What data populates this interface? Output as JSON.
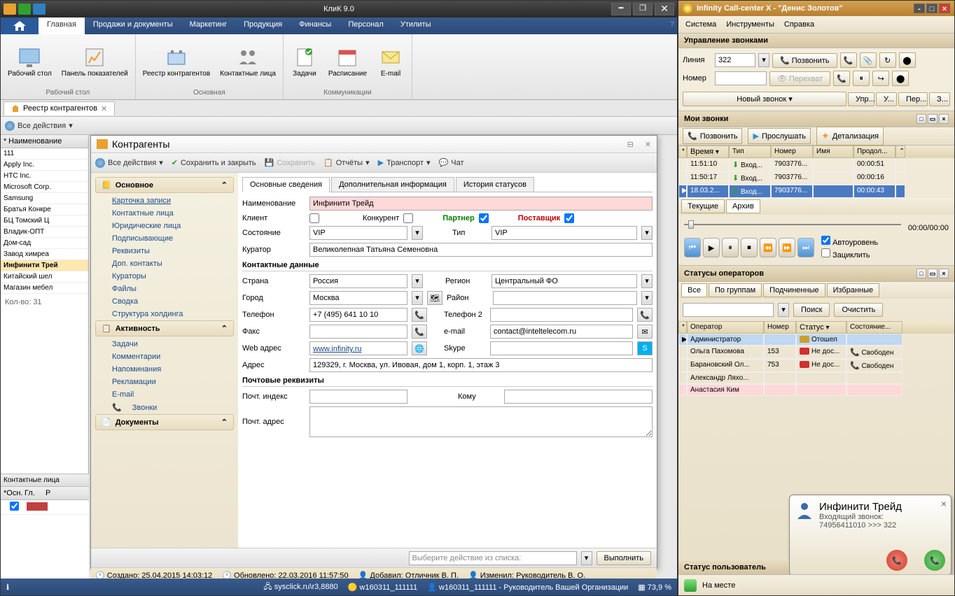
{
  "left": {
    "title": "КлиК 9.0",
    "ribbon": {
      "tabs": [
        "Главная",
        "Продажи и документы",
        "Маркетинг",
        "Продукция",
        "Финансы",
        "Персонал",
        "Утилиты"
      ],
      "groups": [
        {
          "label": "Рабочий стол",
          "items": [
            {
              "label": "Рабочий\nстол"
            },
            {
              "label": "Панель\nпоказателей"
            }
          ]
        },
        {
          "label": "Основная",
          "items": [
            {
              "label": "Реестр\nконтрагентов"
            },
            {
              "label": "Контактные\nлица"
            }
          ]
        },
        {
          "label": "Коммуникации",
          "items": [
            {
              "label": "Задачи"
            },
            {
              "label": "Расписание"
            },
            {
              "label": "E-mail"
            }
          ]
        }
      ]
    },
    "docTab": "Реестр контрагентов",
    "allActions": "Все действия",
    "listHeader": "Наименование",
    "listRows": [
      "111",
      "Apply Inc.",
      "HTC Inc.",
      "Microsoft Corp.",
      "Samsung",
      "Братья Конкре",
      "БЦ Томский Ц",
      "Владик-ОПТ",
      "Дом-сад",
      "Завод химреа",
      "Инфинити Трей",
      "Китайский шел",
      "Магазин мебел"
    ],
    "countLabel": "Кол-во: 31",
    "contactsTitle": "Контактные лица",
    "contactsCols": [
      "Осн.",
      "Гл.",
      "Р"
    ],
    "status": {
      "server": "sysclick.ru\\r3,8880",
      "w1": "w160311_111111",
      "w2": "w160311_111111 - Руководитель Вашей Организации",
      "pct": "73,9 %"
    }
  },
  "modal": {
    "title": "Контрагенты",
    "toolbar": {
      "allActions": "Все действия",
      "saveClose": "Сохранить и закрыть",
      "save": "Сохранить",
      "reports": "Отчёты",
      "transport": "Транспорт",
      "chat": "Чат"
    },
    "navGroups": [
      {
        "title": "Основное",
        "items": [
          "Карточка записи",
          "Контактные лица",
          "Юридические лица",
          "Подписывающие",
          "Реквизиты",
          "Доп. контакты",
          "Кураторы",
          "Файлы",
          "Сводка",
          "Структура холдинга"
        ]
      },
      {
        "title": "Активность",
        "items": [
          "Задачи",
          "Комментарии",
          "Напоминания",
          "Рекламации",
          "E-mail",
          "Звонки"
        ]
      },
      {
        "title": "Документы",
        "items": []
      }
    ],
    "formTabs": [
      "Основные сведения",
      "Дополнительная информация",
      "История статусов"
    ],
    "fields": {
      "nameLabel": "Наименование",
      "name": "Инфинити Трейд",
      "clientLabel": "Клиент",
      "competitorLabel": "Конкурент",
      "partnerLabel": "Партнер",
      "supplierLabel": "Поставщик",
      "stateLabel": "Состояние",
      "state": "VIP",
      "typeLabel": "Тип",
      "type": "VIP",
      "curatorLabel": "Куратор",
      "curator": "Великолепная Татьяна Семеновна",
      "contactSection": "Контактные данные",
      "countryLabel": "Страна",
      "country": "Россия",
      "regionLabel": "Регион",
      "region": "Центральный ФО",
      "cityLabel": "Город",
      "city": "Москва",
      "districtLabel": "Район",
      "district": "",
      "phoneLabel": "Телефон",
      "phone": "+7 (495) 641 10 10",
      "phone2Label": "Телефон 2",
      "phone2": "",
      "faxLabel": "Факс",
      "fax": "",
      "emailLabel": "e-mail",
      "email": "contact@inteltelecom.ru",
      "webLabel": "Web адрес",
      "web": "www.infinity.ru",
      "skypeLabel": "Skype",
      "skype": "",
      "addrLabel": "Адрес",
      "addr": "129329, г. Москва, ул. Ивовая, дом 1, корп. 1, этаж 3",
      "postSection": "Почтовые реквизиты",
      "postcodeLabel": "Почт. индекс",
      "toLabel": "Кому",
      "postAddrLabel": "Почт. адрес"
    },
    "actionPrompt": "Выберите действие из списка:",
    "execute": "Выполнить",
    "footer": {
      "created": "Создано: 25.04.2015 14:03:12",
      "updated": "Обновлено: 22.03.2016 11:57:50",
      "added": "Добавил: Отличник В. П.",
      "changed": "Изменил: Руководитель В. О."
    }
  },
  "right": {
    "title": "Infinity Call-center X - \"Денис Золотов\"",
    "menu": [
      "Система",
      "Инструменты",
      "Справка"
    ],
    "callCtrlTitle": "Управление звонками",
    "lineLabel": "Линия",
    "lineValue": "322",
    "numberLabel": "Номер",
    "numberValue": "",
    "callBtn": "Позвонить",
    "interceptBtn": "Перехват",
    "tabBar": [
      "Новый звонок",
      "Упр...",
      "У...",
      "Пер...",
      "З..."
    ],
    "myCallsTitle": "Мои звонки",
    "actionBtns": {
      "call": "Позвонить",
      "listen": "Прослушать",
      "detail": "Детализация"
    },
    "callsCols": [
      "Время",
      "Тип",
      "Номер",
      "Имя",
      "Продол..."
    ],
    "callsRows": [
      {
        "time": "11:51:10",
        "type": "Вход...",
        "num": "7903776...",
        "name": "",
        "dur": "00:00:51"
      },
      {
        "time": "11:50:17",
        "type": "Вход...",
        "num": "7903776...",
        "name": "",
        "dur": "00:00:16"
      },
      {
        "time": "18.03.2...",
        "type": "Вход...",
        "num": "7903776...",
        "name": "",
        "dur": "00:00:43",
        "sel": true
      }
    ],
    "callTabs": [
      "Текущие",
      "Архив"
    ],
    "playerTime": "00:00/00:00",
    "autoLevel": "Автоуровень",
    "loop": "Зациклить",
    "opStatusTitle": "Статусы операторов",
    "opTabs": [
      "Все",
      "По группам",
      "Подчиненные",
      "Избранные"
    ],
    "search": "Поиск",
    "clear": "Очистить",
    "opCols": [
      "Оператор",
      "Номер",
      "Статус",
      "Состояние..."
    ],
    "opRows": [
      {
        "name": "Администратор",
        "num": "",
        "status": "Отошел",
        "sc": "#c8a030",
        "state": "",
        "stc": ""
      },
      {
        "name": "Ольга Пахомова",
        "num": "153",
        "status": "Не дос...",
        "sc": "#d03030",
        "state": "Свободен",
        "stc": "#30a030"
      },
      {
        "name": "Барановский Ол...",
        "num": "753",
        "status": "Не дос...",
        "sc": "#d03030",
        "state": "Свободен",
        "stc": "#30a030"
      },
      {
        "name": "Александр Ляхо...",
        "num": "",
        "status": "",
        "sc": "",
        "state": "",
        "stc": ""
      },
      {
        "name": "Анастасия Ким",
        "num": "",
        "status": "",
        "sc": "",
        "state": "",
        "stc": "",
        "hl": true
      }
    ],
    "popup": {
      "name": "Инфинити Трейд",
      "sub": "Входящий звонок:",
      "detail": "74956411010 >>> 322"
    },
    "userStatusTitle": "Статус пользователь",
    "userStatus": "На месте"
  }
}
